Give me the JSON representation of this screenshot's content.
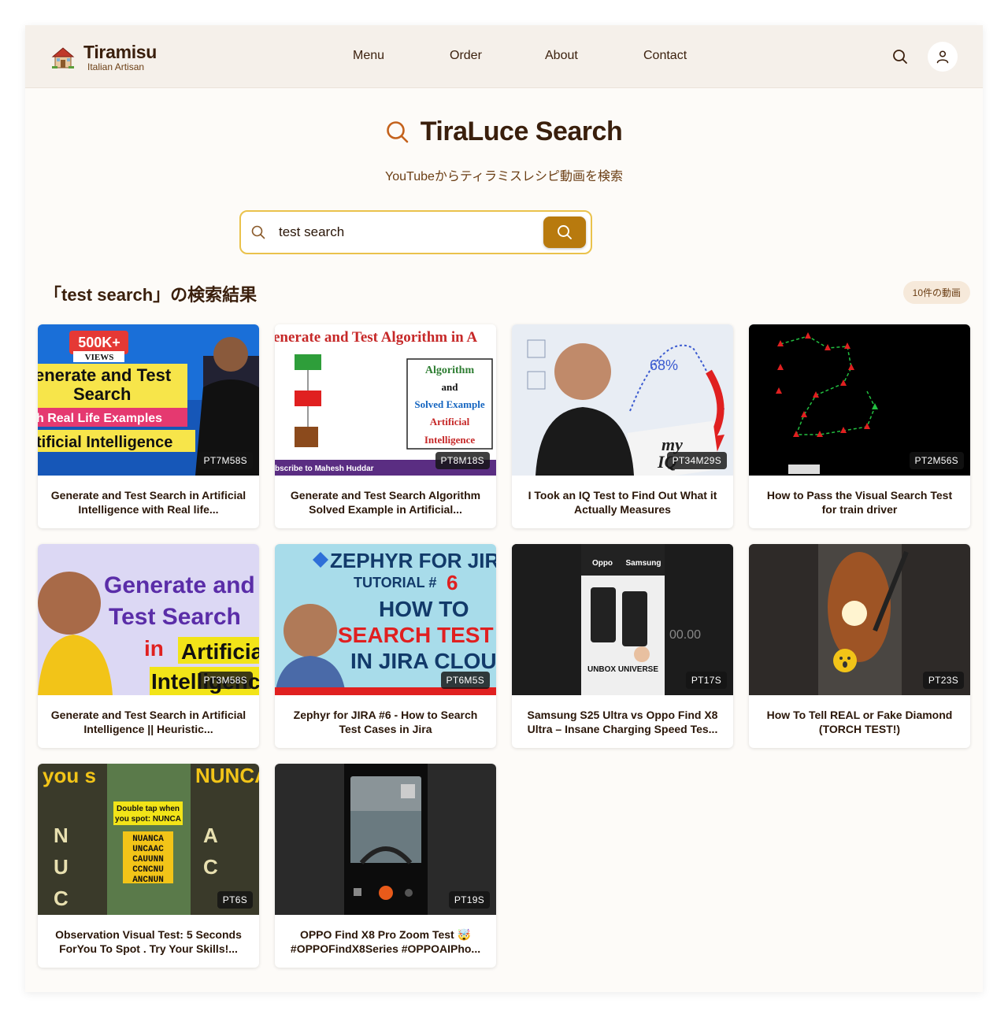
{
  "header": {
    "brand_name": "Tiramisu",
    "brand_sub": "Italian Artisan",
    "nav": [
      "Menu",
      "Order",
      "About",
      "Contact"
    ],
    "icons": [
      "search-icon",
      "user-icon"
    ]
  },
  "hero": {
    "title": "TiraLuce Search",
    "subtitle": "YouTubeからティラミスレシピ動画を検索"
  },
  "search": {
    "value": "test search",
    "placeholder": ""
  },
  "results": {
    "heading": "「test search」の検索結果",
    "count": "10件の動画",
    "videos": [
      {
        "title": "Generate and Test Search in Artificial Intelligence with Real life...",
        "duration": "PT7M58S",
        "thumb_text": [
          "500K+",
          "VIEWS",
          "enerate and Test",
          "Search",
          "h Real Life Examples",
          "tificial Intelligence"
        ]
      },
      {
        "title": "Generate and Test Search Algorithm Solved Example in Artificial...",
        "duration": "PT8M18S",
        "thumb_text": [
          "enerate and Test Algorithm in A",
          "Algorithm",
          "and",
          "Solved Example",
          "Artificial",
          "Intelligence",
          "bscribe to Mahesh Huddar"
        ]
      },
      {
        "title": "I Took an IQ Test to Find Out What it Actually Measures",
        "duration": "PT34M29S",
        "thumb_text": [
          "68%",
          "my",
          "IQ"
        ]
      },
      {
        "title": "How to Pass the Visual Search Test for train driver",
        "duration": "PT2M56S",
        "thumb_text": []
      },
      {
        "title": "Generate and Test Search in Artificial Intelligence || Heuristic...",
        "duration": "PT3M58S",
        "thumb_text": [
          "Generate and",
          "Test Search",
          "in",
          "Artificial",
          "Intelligence"
        ]
      },
      {
        "title": "Zephyr for JIRA #6 - How to Search Test Cases in Jira",
        "duration": "PT6M5S",
        "thumb_text": [
          "ZEPHYR FOR JIRA",
          "TUTORIAL #",
          "6",
          "HOW TO",
          "SEARCH TEST CASE",
          "IN JIRA CLOUD"
        ]
      },
      {
        "title": "Samsung S25 Ultra vs Oppo Find X8 Ultra – Insane Charging Speed Tes...",
        "duration": "PT17S",
        "thumb_text": [
          "Oppo",
          "Samsung",
          "UNBOX UNIVERSE",
          "00.00"
        ]
      },
      {
        "title": "How To Tell REAL or Fake Diamond (TORCH TEST!)",
        "duration": "PT23S",
        "thumb_text": []
      },
      {
        "title": "Observation Visual Test: 5 Seconds ForYou To Spot . Try Your Skills!...",
        "duration": "PT6S",
        "thumb_text": [
          "you s",
          "NUNCA",
          "Double tap when",
          "you spot: NUNCA",
          "NUANCA",
          "UNCAAC",
          "CAUUNN",
          "CCNCNU",
          "ANCNUN"
        ]
      },
      {
        "title": "OPPO Find X8 Pro Zoom Test 🤯 #OPPOFindX8Series #OPPOAIPho...",
        "duration": "PT19S",
        "thumb_text": []
      }
    ]
  },
  "colors": {
    "accent": "#b87a0e",
    "accent_border": "#eac24c",
    "header_bg": "#f5f0ea",
    "text_brown": "#3a1f0c"
  }
}
